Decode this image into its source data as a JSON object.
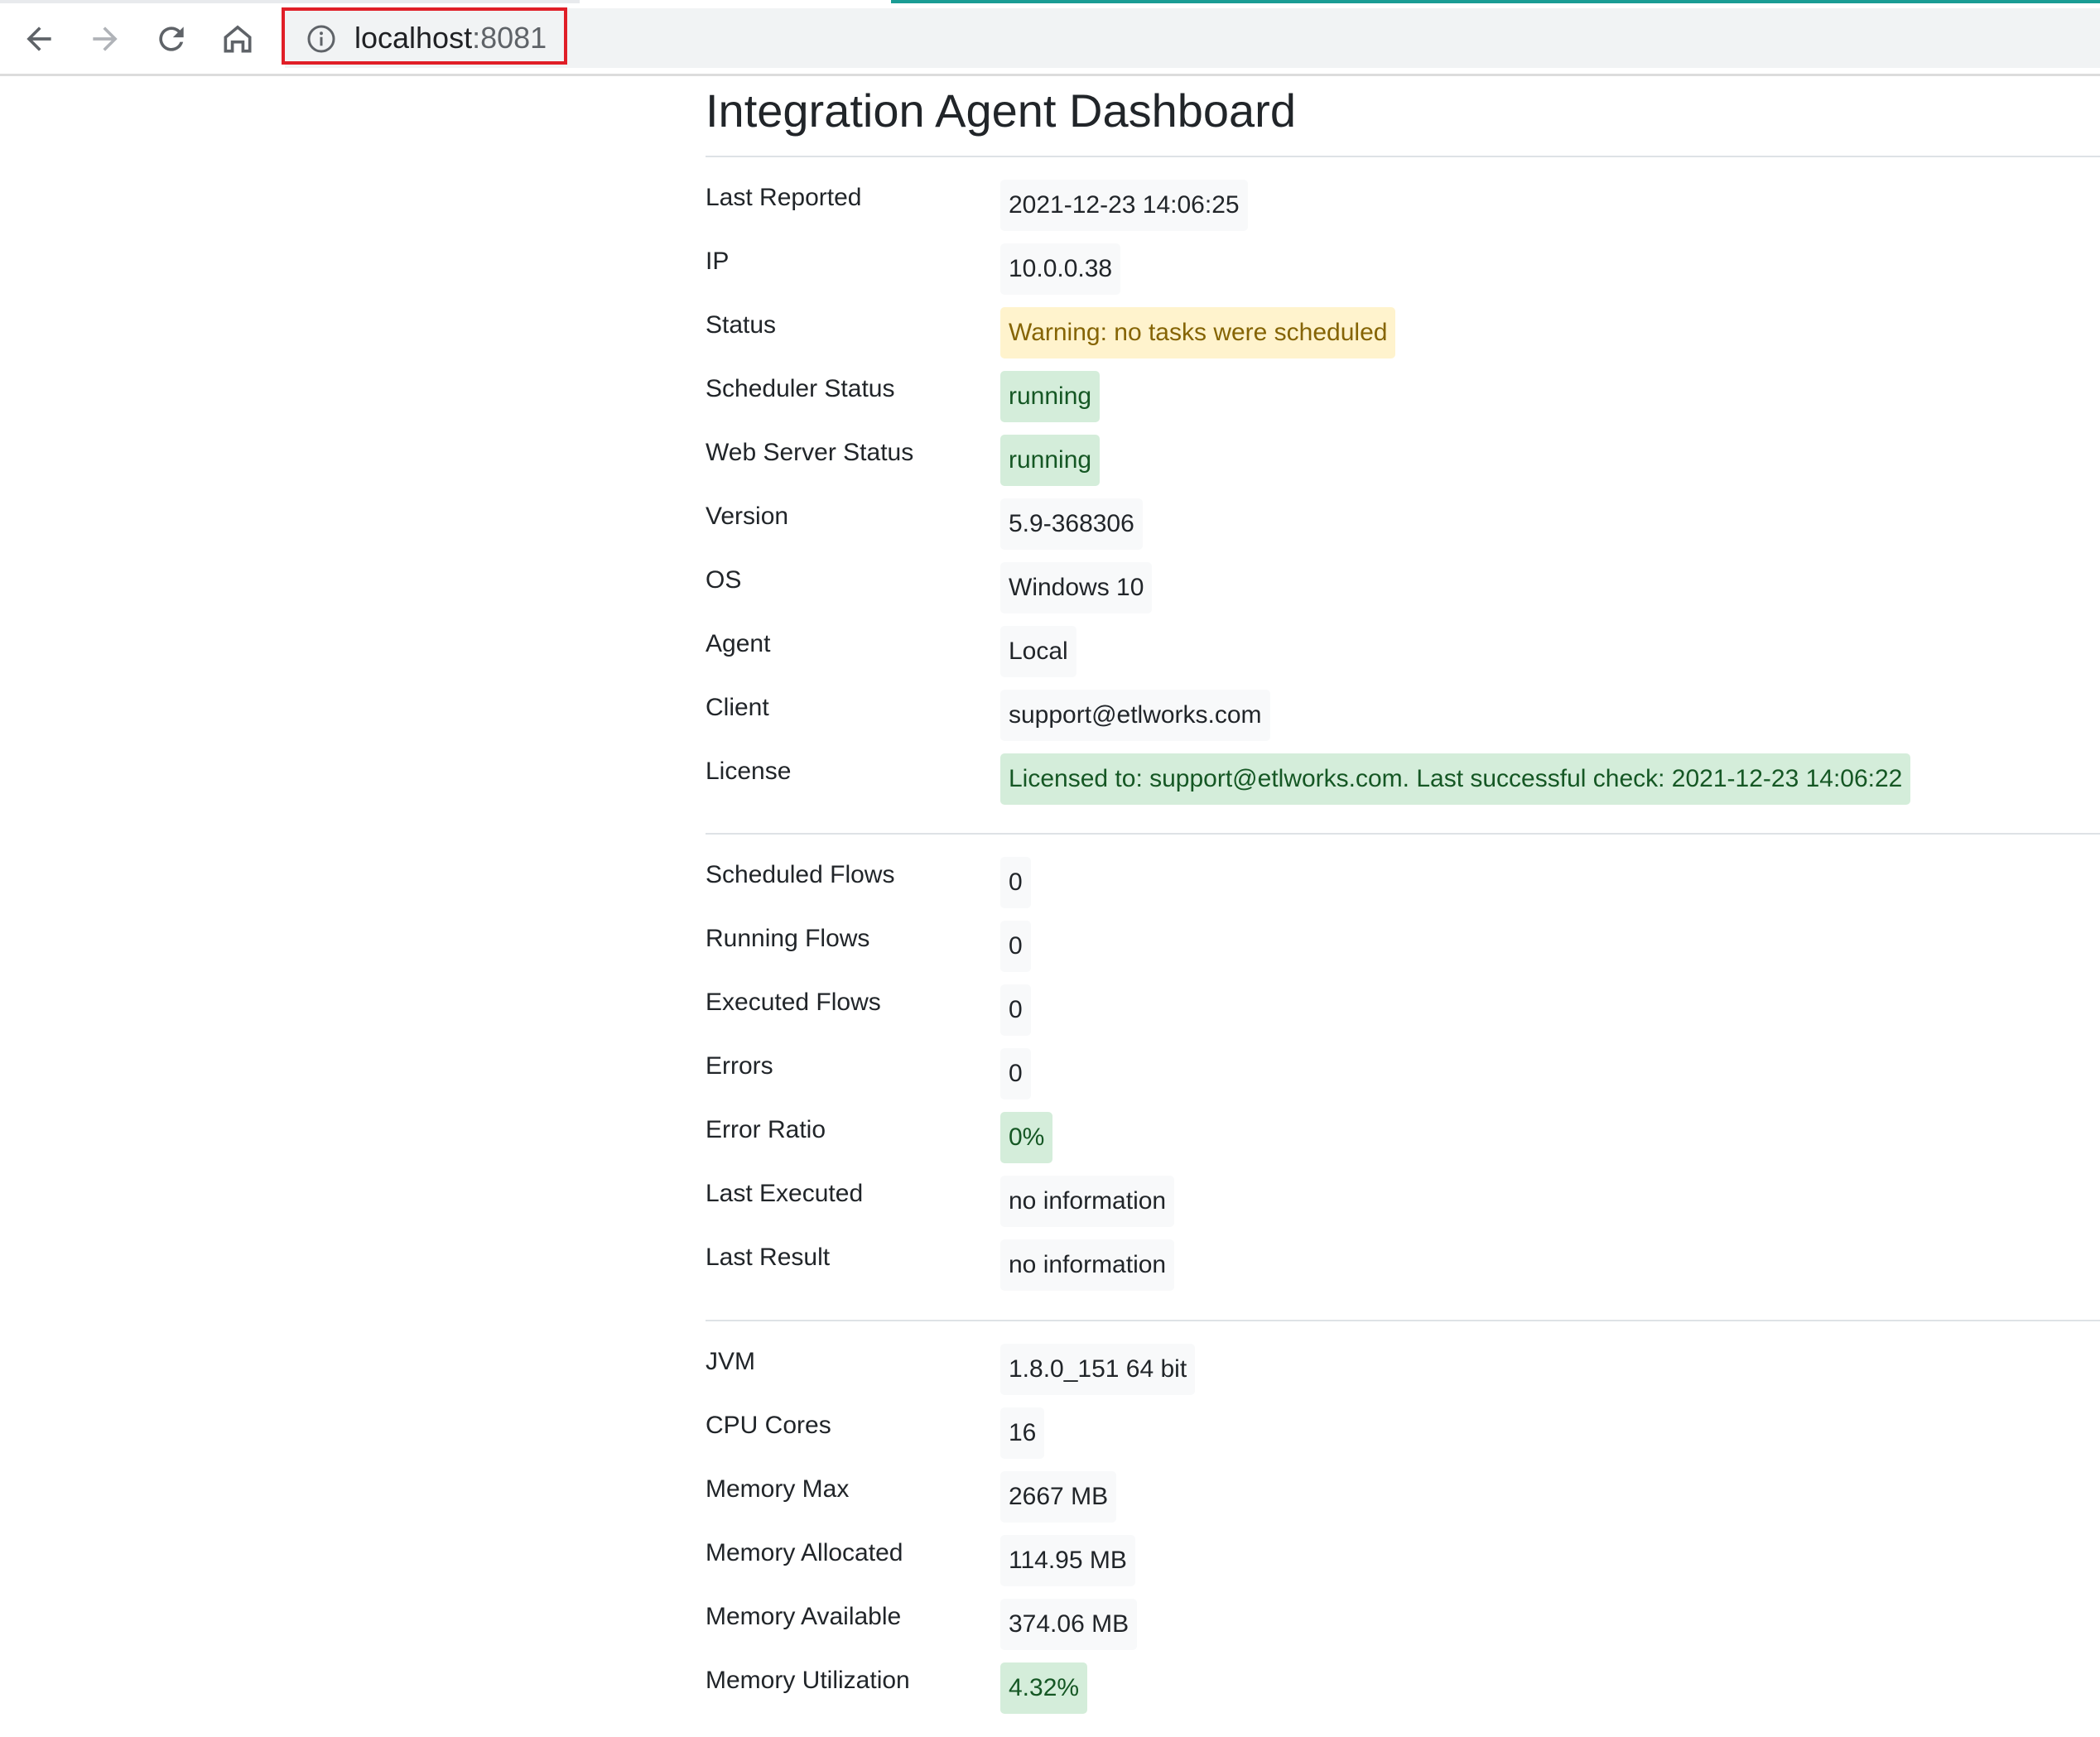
{
  "browser": {
    "url_host": "localhost",
    "url_port": ":8081"
  },
  "page": {
    "title": "Integration Agent Dashboard"
  },
  "colors": {
    "success_bg": "#d4edda",
    "success_text": "#155724",
    "warning_bg": "#fff3cd",
    "warning_text": "#856404",
    "default_bg": "#f8f9fa",
    "highlight_border": "#e01e27",
    "loading_bar": "#1a9c94"
  },
  "sections": [
    {
      "rows": [
        {
          "label": "Last Reported",
          "value": "2021-12-23 14:06:25",
          "style": "default"
        },
        {
          "label": "IP",
          "value": "10.0.0.38",
          "style": "default"
        },
        {
          "label": "Status",
          "value": "Warning: no tasks were scheduled",
          "style": "warning"
        },
        {
          "label": "Scheduler Status",
          "value": "running",
          "style": "success"
        },
        {
          "label": "Web Server Status",
          "value": "running",
          "style": "success"
        },
        {
          "label": "Version",
          "value": "5.9-368306",
          "style": "default"
        },
        {
          "label": "OS",
          "value": "Windows 10",
          "style": "default"
        },
        {
          "label": "Agent",
          "value": "Local",
          "style": "default"
        },
        {
          "label": "Client",
          "value": "support@etlworks.com",
          "style": "default"
        },
        {
          "label": "License",
          "value": "Licensed to: support@etlworks.com. Last successful check: 2021-12-23 14:06:22",
          "style": "success"
        }
      ]
    },
    {
      "rows": [
        {
          "label": "Scheduled Flows",
          "value": "0",
          "style": "default"
        },
        {
          "label": "Running Flows",
          "value": "0",
          "style": "default"
        },
        {
          "label": "Executed Flows",
          "value": "0",
          "style": "default"
        },
        {
          "label": "Errors",
          "value": "0",
          "style": "default"
        },
        {
          "label": "Error Ratio",
          "value": "0%",
          "style": "success"
        },
        {
          "label": "Last Executed",
          "value": "no information",
          "style": "default"
        },
        {
          "label": "Last Result",
          "value": "no information",
          "style": "default"
        }
      ]
    },
    {
      "rows": [
        {
          "label": "JVM",
          "value": "1.8.0_151 64 bit",
          "style": "default"
        },
        {
          "label": "CPU Cores",
          "value": "16",
          "style": "default"
        },
        {
          "label": "Memory Max",
          "value": "2667 MB",
          "style": "default"
        },
        {
          "label": "Memory Allocated",
          "value": "114.95 MB",
          "style": "default"
        },
        {
          "label": "Memory Available",
          "value": "374.06 MB",
          "style": "default"
        },
        {
          "label": "Memory Utilization",
          "value": "4.32%",
          "style": "success"
        }
      ]
    }
  ]
}
